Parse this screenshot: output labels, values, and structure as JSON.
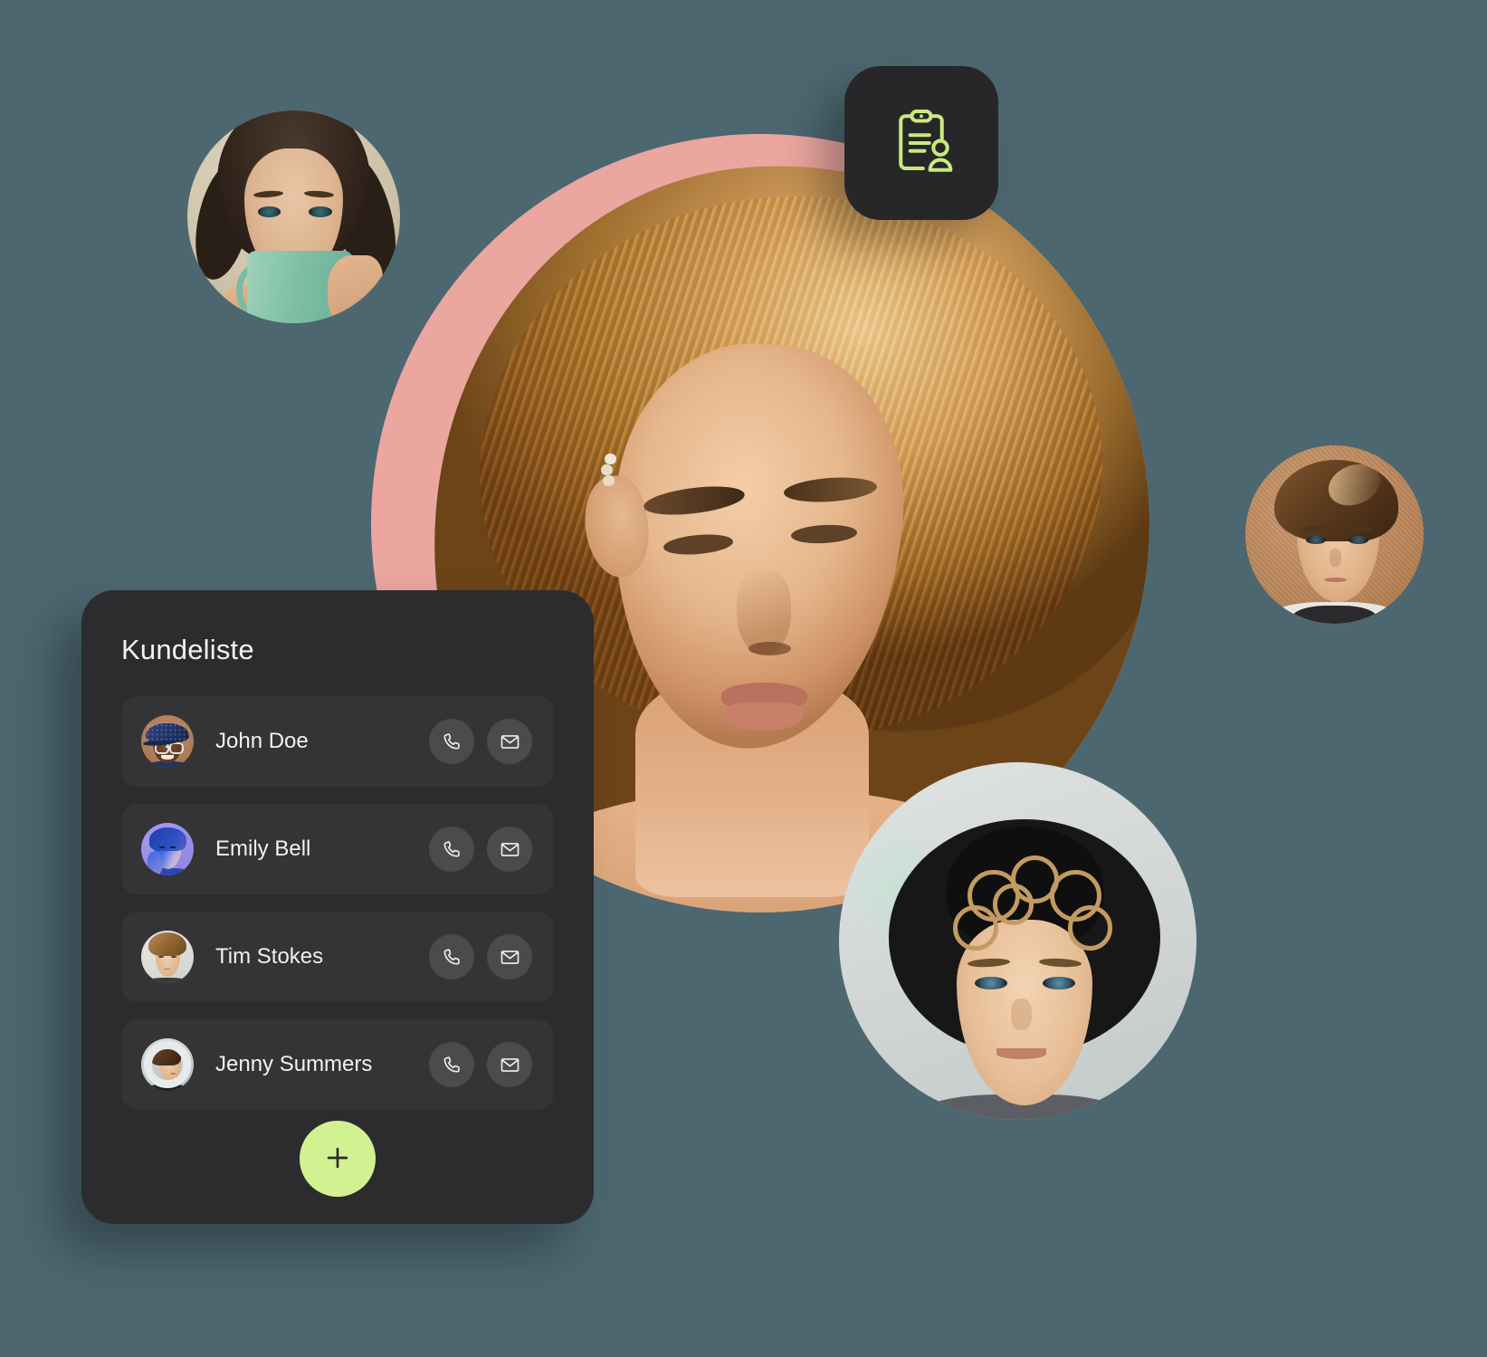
{
  "theme": {
    "background": "#4c6770",
    "card_bg": "#2c2c2e",
    "row_bg": "#343436",
    "action_btn_bg": "#4b4b4d",
    "accent_lime": "#d2f291",
    "badge_bg": "#272729",
    "hero_backdrop_pink": "#eaa69f",
    "text_primary": "#f1f1f1"
  },
  "card": {
    "title": "Kundeliste",
    "add_button_label": "+",
    "add_button_name": "plus-icon",
    "contacts": [
      {
        "name": "John Doe",
        "avatar_alt": "Smiling man wearing a blue flat cap and glasses",
        "call_label": "Call",
        "mail_label": "Email"
      },
      {
        "name": "Emily Bell",
        "avatar_alt": "Woman portrait with purple and blue duotone effect",
        "call_label": "Call",
        "mail_label": "Email"
      },
      {
        "name": "Tim Stokes",
        "avatar_alt": "Young man with curly light brown hair",
        "call_label": "Call",
        "mail_label": "Email"
      },
      {
        "name": "Jenny Summers",
        "avatar_alt": "Woman with hair tied back in profile",
        "call_label": "Call",
        "mail_label": "Email"
      }
    ]
  },
  "badge": {
    "icon": "clipboard-user-icon",
    "icon_color": "#c9e97f"
  },
  "hero": {
    "alt": "Portrait of a woman with long blonde hair on a pink circular backdrop"
  },
  "floating_avatars": [
    {
      "id": "avatar-woman-mug",
      "alt": "Woman drinking from a mint green mug"
    },
    {
      "id": "avatar-young-man",
      "alt": "Young man with brown hair against a terracotta wall"
    },
    {
      "id": "avatar-man-hat",
      "alt": "Curly blond man wearing a black hat"
    }
  ]
}
